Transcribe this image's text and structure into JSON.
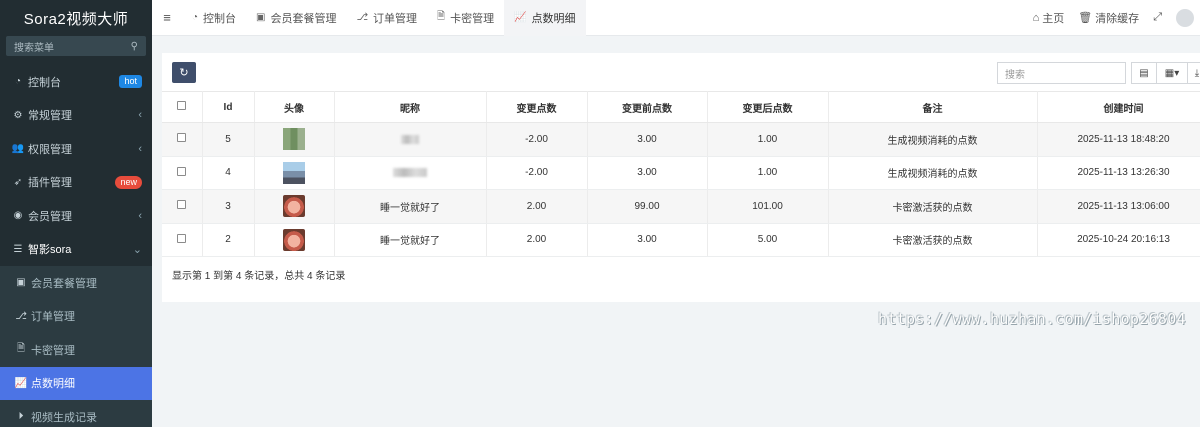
{
  "app": {
    "title": "Sora2视频大师"
  },
  "sidebar": {
    "search_placeholder": "搜索菜单",
    "items": [
      {
        "label": "控制台",
        "icon": "dashboard-icon",
        "badge": "hot"
      },
      {
        "label": "常规管理",
        "icon": "gears-icon",
        "chevron": "‹"
      },
      {
        "label": "权限管理",
        "icon": "users-icon",
        "chevron": "‹"
      },
      {
        "label": "插件管理",
        "icon": "rocket-icon",
        "badge": "new"
      },
      {
        "label": "会员管理",
        "icon": "user-circle-icon",
        "chevron": "‹"
      },
      {
        "label": "智影sora",
        "icon": "list-icon",
        "chevron": "⌄"
      }
    ],
    "subitems": [
      {
        "label": "会员套餐管理",
        "icon": "card-icon"
      },
      {
        "label": "订单管理",
        "icon": "flow-icon"
      },
      {
        "label": "卡密管理",
        "icon": "file-icon"
      },
      {
        "label": "点数明细",
        "icon": "chart-icon"
      },
      {
        "label": "视频生成记录",
        "icon": "play-circle-icon"
      }
    ]
  },
  "topbar": {
    "tabs": [
      {
        "label": "控制台",
        "icon": "dashboard-icon"
      },
      {
        "label": "会员套餐管理",
        "icon": "card-icon"
      },
      {
        "label": "订单管理",
        "icon": "flow-icon"
      },
      {
        "label": "卡密管理",
        "icon": "file-icon"
      },
      {
        "label": "点数明细",
        "icon": "chart-icon"
      }
    ],
    "home_label": "主页",
    "clear_cache_label": "清除缓存"
  },
  "toolbar": {
    "search_placeholder": "搜索"
  },
  "table": {
    "columns": [
      "Id",
      "头像",
      "昵称",
      "变更点数",
      "变更前点数",
      "变更后点数",
      "备注",
      "创建时间"
    ],
    "rows": [
      {
        "id": "5",
        "nickname": "",
        "change": "-2.00",
        "before": "3.00",
        "after": "1.00",
        "remark": "生成视频消耗的点数",
        "created": "2025-11-13 18:48:20"
      },
      {
        "id": "4",
        "nickname": "",
        "change": "-2.00",
        "before": "3.00",
        "after": "1.00",
        "remark": "生成视频消耗的点数",
        "created": "2025-11-13 13:26:30"
      },
      {
        "id": "3",
        "nickname": "睡一觉就好了",
        "change": "2.00",
        "before": "99.00",
        "after": "101.00",
        "remark": "卡密激活获的点数",
        "created": "2025-11-13 13:06:00"
      },
      {
        "id": "2",
        "nickname": "睡一觉就好了",
        "change": "2.00",
        "before": "3.00",
        "after": "5.00",
        "remark": "卡密激活获的点数",
        "created": "2025-10-24 20:16:13"
      }
    ],
    "summary": "显示第 1 到第 4 条记录，总共 4 条记录"
  },
  "watermark": "https://www.huzhan.com/ishop26804"
}
